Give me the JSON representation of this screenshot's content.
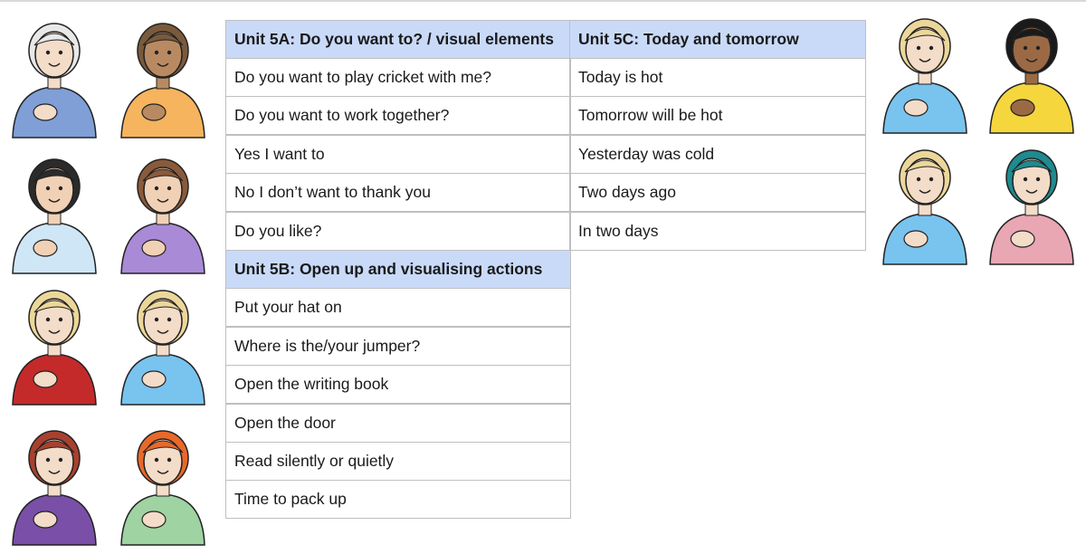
{
  "tables": {
    "unit_5a": {
      "heading": "Unit 5A: Do you want to? / visual elements",
      "rows": [
        "Do you want to play cricket with me?",
        "Do you want to work together?",
        "Yes I want to",
        "No I don’t want to thank you",
        "Do you like?"
      ]
    },
    "unit_5b": {
      "heading": "Unit 5B: Open up and visualising actions",
      "rows": [
        "Put your hat on",
        "Where is the/your jumper?",
        "Open the writing book",
        "Open the door",
        "Read silently or quietly",
        "Time to pack up"
      ]
    },
    "unit_5c": {
      "heading": "Unit 5C: Today and tomorrow",
      "rows": [
        "Today is hot",
        "Tomorrow will be hot",
        "Yesterday was cold",
        "Two days ago",
        "In two days"
      ]
    }
  },
  "illustrations": [
    {
      "name": "signer-grandmother-illustration",
      "hair": "#e8e8e8",
      "skin": "#f3dcc8",
      "shirt": "#7f9fd6"
    },
    {
      "name": "signer-bald-man-apron-illustration",
      "hair": "#7a5a3c",
      "skin": "#b98a62",
      "shirt": "#f5b45d"
    },
    {
      "name": "signer-man-glasses-tie-illustration",
      "hair": "#2b2b2b",
      "skin": "#f1d1b5",
      "shirt": "#cfe6f7"
    },
    {
      "name": "signer-long-brown-hair-illustration",
      "hair": "#8a5a3a",
      "skin": "#f1d1b5",
      "shirt": "#a98ad6"
    },
    {
      "name": "signer-blonde-red-top-illustration",
      "hair": "#ecd79a",
      "skin": "#f3dcc8",
      "shirt": "#c42a2a"
    },
    {
      "name": "signer-boy-hand-on-head-illustration",
      "hair": "#ecd79a",
      "skin": "#f3dcc8",
      "shirt": "#79c3ef"
    },
    {
      "name": "signer-red-hair-woman-illustration",
      "hair": "#a8412f",
      "skin": "#f3dcc8",
      "shirt": "#7a4fa8"
    },
    {
      "name": "signer-ginger-curly-glasses-illustration",
      "hair": "#e8692a",
      "skin": "#f3dcc8",
      "shirt": "#9fd3a2"
    },
    {
      "name": "signer-boy-today-illustration",
      "hair": "#ecd79a",
      "skin": "#f3dcc8",
      "shirt": "#79c3ef"
    },
    {
      "name": "signer-girl-curly-hair-illustration",
      "hair": "#1a1a1a",
      "skin": "#9b6a45",
      "shirt": "#f5d63d"
    },
    {
      "name": "signer-boy-days-illustration",
      "hair": "#ecd79a",
      "skin": "#f3dcc8",
      "shirt": "#79c3ef"
    },
    {
      "name": "signer-woman-hijab-illustration",
      "hair": "#1f8a8f",
      "skin": "#f3dcc8",
      "shirt": "#e9a6b3"
    }
  ],
  "colors": {
    "header_bg": "#c9daf8",
    "border": "#bfbfbf",
    "text": "#1a1a1a"
  }
}
